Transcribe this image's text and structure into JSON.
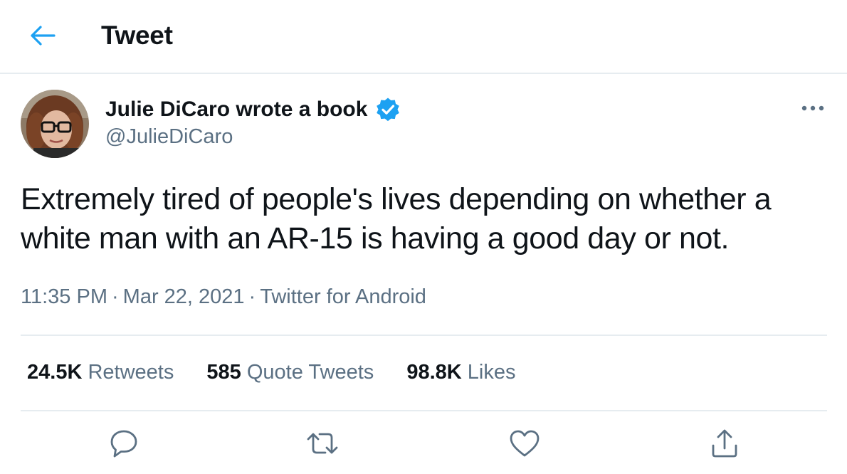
{
  "header": {
    "title": "Tweet",
    "back_icon": "arrow-left-icon"
  },
  "author": {
    "display_name": "Julie DiCaro wrote a book",
    "handle": "@JulieDiCaro",
    "verified_icon": "verified-badge-icon"
  },
  "tweet": {
    "text": "Extremely tired of people's lives depending on whether a white man with an AR-15 is having a good day or not.",
    "time": "11:35 PM",
    "date": "Mar 22, 2021",
    "source": "Twitter for Android",
    "separator": "·"
  },
  "stats": {
    "retweets_count": "24.5K",
    "retweets_label": "Retweets",
    "quotes_count": "585",
    "quotes_label": "Quote Tweets",
    "likes_count": "98.8K",
    "likes_label": "Likes"
  },
  "actions": [
    "reply-icon",
    "retweet-icon",
    "like-icon",
    "share-icon"
  ],
  "colors": {
    "accent": "#1da1f2",
    "secondary_text": "#5b7083",
    "divider": "#e6ecf0"
  }
}
